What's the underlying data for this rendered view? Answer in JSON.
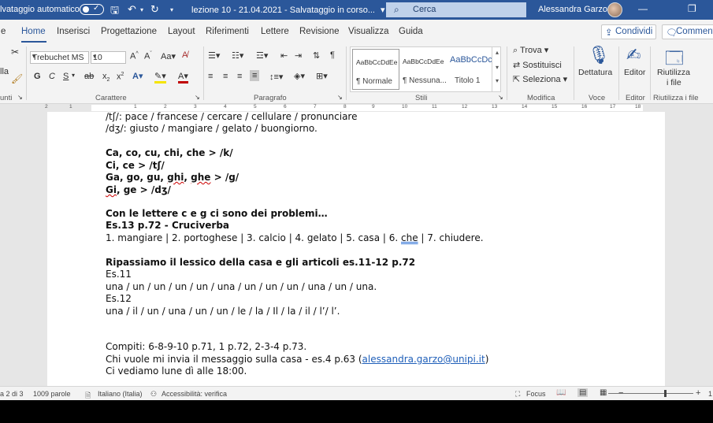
{
  "titlebar": {
    "autosave_label": "lvataggio automatico",
    "document_title": "lezione 10 - 21.04.2021 - Salvataggio in corso...",
    "title_dropdown": "▾",
    "search_placeholder": "Cerca",
    "user_name": "Alessandra Garzo"
  },
  "tabs": {
    "file_partial": "e",
    "items": [
      "Home",
      "Inserisci",
      "Progettazione",
      "Layout",
      "Riferimenti",
      "Lettere",
      "Revisione",
      "Visualizza",
      "Guida"
    ],
    "share": "Condividi",
    "comments": "Commenti"
  },
  "ribbon": {
    "clipboard_partial": "lla",
    "clipboard_label": "unti",
    "font_name": "Trebuchet MS",
    "font_size": "10",
    "font_group_label": "Carattere",
    "paragraph_group_label": "Paragrafo",
    "styles": [
      {
        "preview": "AaBbCcDdEe",
        "name": "¶ Normale"
      },
      {
        "preview": "AaBbCcDdEe",
        "name": "¶ Nessuna..."
      },
      {
        "preview": "AaBbCcDc",
        "name": "Titolo 1"
      }
    ],
    "styles_group_label": "Stili",
    "find": "Trova",
    "replace": "Sostituisci",
    "select": "Seleziona",
    "edit_group_label": "Modifica",
    "dictate": "Dettatura",
    "voice_group_label": "Voce",
    "editor": "Editor",
    "editor_group_label": "Editor",
    "reuse_line1": "Riutilizza",
    "reuse_line2": "i file",
    "reuse_group_label": "Riutilizza i file"
  },
  "ruler": {
    "numbers": [
      "2",
      "1",
      "1",
      "2",
      "3",
      "4",
      "5",
      "6",
      "7",
      "8",
      "9",
      "10",
      "11",
      "12",
      "13",
      "14",
      "15",
      "16",
      "17",
      "18"
    ]
  },
  "document": {
    "line1": "/tʃ/: pace / francese / cercare / cellulare / pronunciare",
    "line2": "/dʒ/: giusto / mangiare / gelato / buongiorno.",
    "rule1": "Ca, co, cu, chi, che > /k/",
    "rule2": "Ci, ce > /tʃ/",
    "rule3_a": "Ga, go, gu, ",
    "rule3_b": "ghi",
    "rule3_c": ", ",
    "rule3_d": "ghe",
    "rule3_e": " > /g/",
    "rule4_a": "Gi",
    "rule4_b": ", ge > /dʒ/",
    "problems": "Con le lettere c e g ci sono dei problemi…",
    "exercise13": "Es.13 p.72 - Cruciverba",
    "answers13_a": "1. mangiare | 2. portoghese | 3. calcio | 4. gelato | 5. casa | 6. ",
    "answers13_b": "che",
    "answers13_c": " | 7. chiudere.",
    "review": "Ripassiamo il lessico della casa e gli articoli es.11-12 p.72",
    "es11": "Es.11",
    "answers11": "una / un / un / un / un / una / un / un / un / una / un / una.",
    "es12": "Es.12",
    "answers12": "una / il / un / una / un / un / le / la / Il / la / il / l’/ l’.",
    "homework": "Compiti: 6-8-9-10 p.71, 1 p.72, 2-3-4 p.73.",
    "message_a": "Chi vuole mi invia il messaggio sulla casa - es.4 p.63 (",
    "message_email": "alessandra.garzo@unipi.it",
    "message_b": ")",
    "closing": "Ci vediamo lune dì alle 18:00."
  },
  "status": {
    "page": "a 2 di 3",
    "words": "1009 parole",
    "language": "Italiano (Italia)",
    "accessibility": "Accessibilità: verifica",
    "focus": "Focus",
    "zoom_end": "1"
  }
}
